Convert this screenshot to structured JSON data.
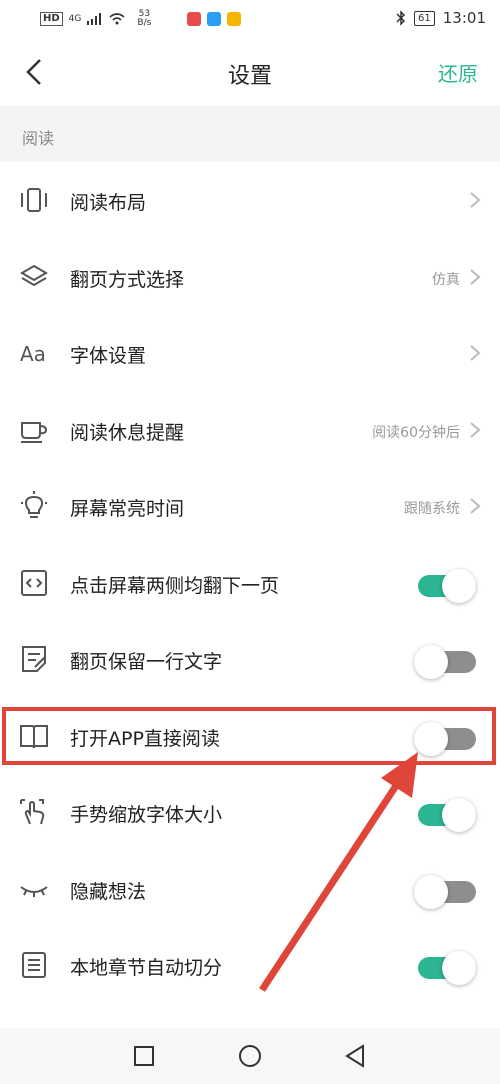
{
  "status_bar": {
    "hd": "HD",
    "signal": "4G",
    "net_speed_value": "53",
    "net_speed_unit": "B/s",
    "battery": "61",
    "time": "13:01",
    "app_icon_colors": [
      "#e84b4b",
      "#2a9df4",
      "#f5b400"
    ]
  },
  "header": {
    "title": "设置",
    "restore_label": "还原"
  },
  "section": {
    "label": "阅读"
  },
  "settings": [
    {
      "label": "阅读布局",
      "value": "",
      "control": "chevron",
      "icon": "layout-icon"
    },
    {
      "label": "翻页方式选择",
      "value": "仿真",
      "control": "chevron",
      "icon": "layers-icon"
    },
    {
      "label": "字体设置",
      "value": "",
      "control": "chevron",
      "icon": "font-icon",
      "icon_text": "Aa"
    },
    {
      "label": "阅读休息提醒",
      "value": "阅读60分钟后",
      "control": "chevron",
      "icon": "cup-icon"
    },
    {
      "label": "屏幕常亮时间",
      "value": "跟随系统",
      "control": "chevron",
      "icon": "bulb-icon"
    },
    {
      "label": "点击屏幕两侧均翻下一页",
      "value": "",
      "control": "toggle",
      "on": true,
      "icon": "code-icon"
    },
    {
      "label": "翻页保留一行文字",
      "value": "",
      "control": "toggle",
      "on": false,
      "icon": "note-icon"
    },
    {
      "label": "打开APP直接阅读",
      "value": "",
      "control": "toggle",
      "on": false,
      "icon": "book-icon"
    },
    {
      "label": "手势缩放字体大小",
      "value": "",
      "control": "toggle",
      "on": true,
      "icon": "gesture-icon"
    },
    {
      "label": "隐藏想法",
      "value": "",
      "control": "toggle",
      "on": false,
      "icon": "eye-closed-icon"
    },
    {
      "label": "本地章节自动切分",
      "value": "",
      "control": "toggle",
      "on": true,
      "icon": "list-icon"
    }
  ],
  "colors": {
    "accent": "#2bb592",
    "toggle_off": "#8e8e8e",
    "annotation": "#e0453a"
  }
}
